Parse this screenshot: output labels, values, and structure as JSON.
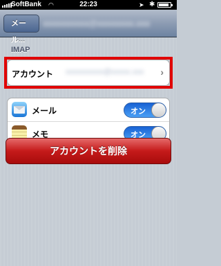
{
  "status_bar": {
    "carrier": "SoftBank",
    "time": "22:23",
    "wifi_icon": "wifi-icon",
    "location_icon": "location-arrow-icon",
    "bluetooth_icon": "bluetooth-icon",
    "battery_icon": "battery-icon"
  },
  "nav": {
    "back_label": "メール...",
    "title": "xxxxxxxxxx@xxxxxxxx.xxx"
  },
  "section": {
    "header": "IMAP"
  },
  "account": {
    "label": "アカウント",
    "value": "xxxxxxxxxx@xxxxx.xxx"
  },
  "services": [
    {
      "label": "メール",
      "icon": "mail-icon",
      "toggle_label": "オン",
      "on": true
    },
    {
      "label": "メモ",
      "icon": "notes-icon",
      "toggle_label": "オン",
      "on": true
    }
  ],
  "delete_button": {
    "label": "アカウントを削除"
  },
  "colors": {
    "highlight": "#e00000",
    "toggle_on": "#2f83e6",
    "delete": "#c51a1a"
  }
}
